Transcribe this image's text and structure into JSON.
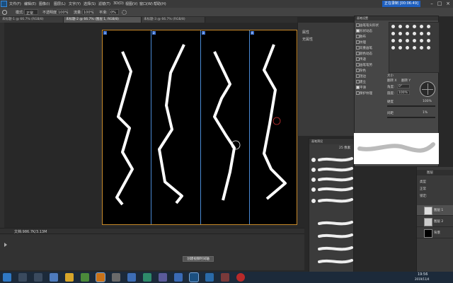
{
  "menubar": {
    "items": [
      "文件(F)",
      "编辑(E)",
      "图像(I)",
      "图层(L)",
      "文字(Y)",
      "选择(S)",
      "滤镜(T)",
      "3D(D)",
      "视图(V)",
      "窗口(W)",
      "帮助(H)"
    ],
    "recording": "正在录制 [00:06:49]"
  },
  "options": {
    "mode_label": "模式:",
    "mode_value": "正常",
    "opacity_label": "不透明度:",
    "opacity_value": "100%",
    "flow_label": "流量:",
    "flow_value": "100%",
    "smooth_label": "平滑:",
    "smooth_value": "0%"
  },
  "tabs": [
    {
      "label": "未标题-1 @ 66.7% (RGB/8)"
    },
    {
      "label": "未标题-2 @ 66.7% (图层 1, RGB/8)"
    },
    {
      "label": "未标题-3 @ 66.7% (RGB/8)"
    }
  ],
  "canvas": {
    "panel_badges": [
      "1",
      "2",
      "3",
      "4"
    ]
  },
  "status": {
    "doc": "文档:986.7K/3.13M"
  },
  "timeline": {
    "create_button": "创建视频时间轴"
  },
  "brush_settings": {
    "title": "画笔设置",
    "items": [
      {
        "label": "画笔笔尖形状",
        "checked": false
      },
      {
        "label": "形状动态",
        "checked": true
      },
      {
        "label": "散布",
        "checked": false
      },
      {
        "label": "纹理",
        "checked": false
      },
      {
        "label": "双重画笔",
        "checked": false
      },
      {
        "label": "颜色动态",
        "checked": false
      },
      {
        "label": "传递",
        "checked": false
      },
      {
        "label": "画笔笔势",
        "checked": false
      },
      {
        "label": "杂色",
        "checked": false
      },
      {
        "label": "湿边",
        "checked": false
      },
      {
        "label": "建立",
        "checked": false
      },
      {
        "label": "平滑",
        "checked": true
      },
      {
        "label": "保护纹理",
        "checked": false
      }
    ],
    "size_label": "大小",
    "angle_label": "角度:",
    "angle_value": "0°",
    "roundness_label": "圆度:",
    "roundness_value": "100%",
    "hardness_label": "硬度",
    "hardness_value": "100%",
    "spacing_label": "间距",
    "spacing_value": "1%",
    "flip_x": "翻转 X",
    "flip_y": "翻转 Y"
  },
  "right_dock": {
    "label1": "属性",
    "label2": "无属性"
  },
  "presets": {
    "title": "画笔预设",
    "size_value": "25 像素"
  },
  "layers": {
    "search_label": "类型",
    "mode": "正常",
    "lock_label": "锁定:",
    "rows": [
      {
        "name": "图层 1"
      },
      {
        "name": "图层 2"
      },
      {
        "name": "背景"
      }
    ],
    "button": "图层"
  },
  "taskbar": {
    "time": "19:56",
    "date": "2019/11/4"
  },
  "colors": {
    "doc_border": "#c98a2a",
    "guide": "#4a8ad4",
    "taskbar": "#1c2a3a"
  }
}
